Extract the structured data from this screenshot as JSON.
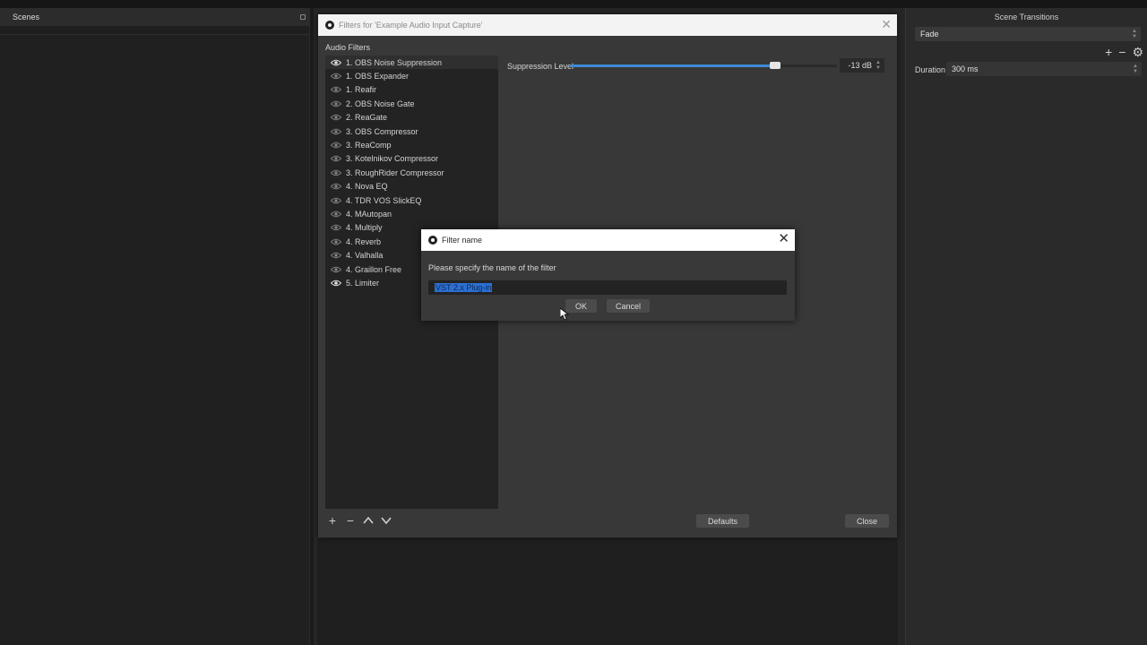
{
  "scenes_dock": {
    "title": "Scenes"
  },
  "transitions_dock": {
    "title": "Scene Transitions",
    "transition_value": "Fade",
    "duration_label": "Duration",
    "duration_value": "300 ms"
  },
  "filters_dialog": {
    "title": "Filters for 'Example Audio Input Capture'",
    "section_label": "Audio Filters",
    "filters": [
      {
        "label": "1. OBS Noise Suppression",
        "visible": true,
        "selected": true
      },
      {
        "label": "1. OBS Expander",
        "visible": false
      },
      {
        "label": "1. Reafir",
        "visible": false
      },
      {
        "label": "2. OBS Noise Gate",
        "visible": false
      },
      {
        "label": "2. ReaGate",
        "visible": false
      },
      {
        "label": "3. OBS Compressor",
        "visible": false
      },
      {
        "label": "3. ReaComp",
        "visible": false
      },
      {
        "label": "3. Kotelnikov Compressor",
        "visible": false
      },
      {
        "label": "3. RoughRider Compressor",
        "visible": false
      },
      {
        "label": "4. Nova EQ",
        "visible": false
      },
      {
        "label": "4. TDR VOS SlickEQ",
        "visible": false
      },
      {
        "label": "4. MAutopan",
        "visible": false
      },
      {
        "label": "4. Multiply",
        "visible": false
      },
      {
        "label": "4. Reverb",
        "visible": false
      },
      {
        "label": "4. Valhalla",
        "visible": false
      },
      {
        "label": "4. Graillon Free",
        "visible": false
      },
      {
        "label": "5. Limiter",
        "visible": true
      }
    ],
    "suppression_label": "Suppression Level",
    "suppression_value": "-13 dB",
    "suppression_fraction": 0.77,
    "defaults_label": "Defaults",
    "close_label": "Close"
  },
  "name_dialog": {
    "title": "Filter name",
    "prompt": "Please specify the name of the filter",
    "input_value": "VST 2.x Plug-in",
    "ok_label": "OK",
    "cancel_label": "Cancel"
  },
  "colors": {
    "accent": "#3f8ad6",
    "selection": "#2c6fd1"
  }
}
